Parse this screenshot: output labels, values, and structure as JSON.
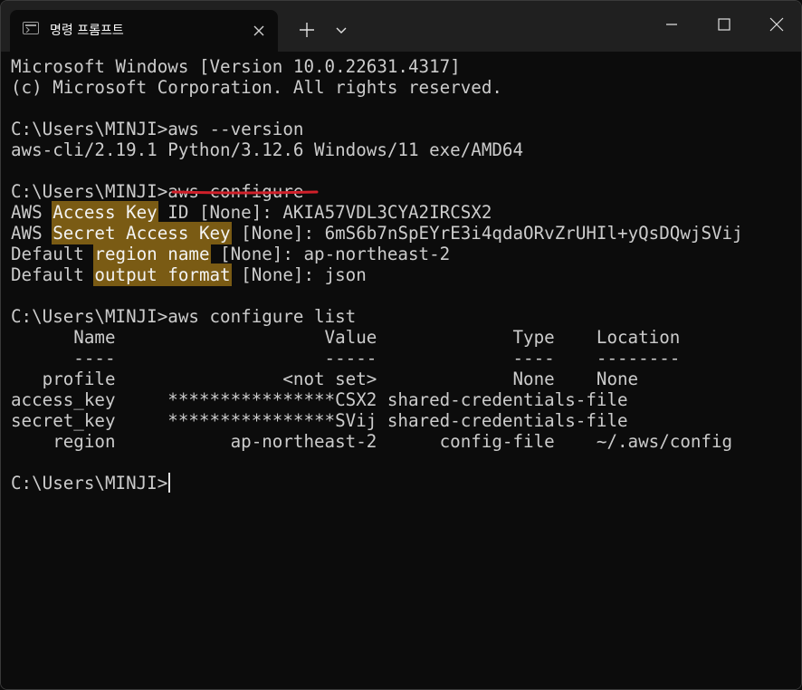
{
  "tab": {
    "title": "명령 프롬프트"
  },
  "icons": {
    "tab_icon": "terminal-icon",
    "tab_close": "close-icon",
    "new_tab": "plus-icon",
    "dropdown": "chevron-down-icon",
    "minimize": "minimize-icon",
    "maximize": "maximize-icon",
    "close": "close-icon"
  },
  "colors": {
    "highlight": "#7a5b14",
    "underline": "#d0202a",
    "text": "#cccccc",
    "background": "#0c0c0c"
  },
  "terminal": {
    "l1": "Microsoft Windows [Version 10.0.22631.4317]",
    "l2": "(c) Microsoft Corporation. All rights reserved.",
    "l4": "C:\\Users\\MINJI>aws --version",
    "l5": "aws-cli/2.19.1 Python/3.12.6 Windows/11 exe/AMD64",
    "l7_prompt": "C:\\Users\\MINJI>",
    "l7_cmd": "aws configure",
    "l8_a": "AWS ",
    "l8_hl": "Access Key",
    "l8_b": " ID [None]: AKIA57VDL3CYA2IRCSX2",
    "l9_a": "AWS ",
    "l9_hl": "Secret Access Key",
    "l9_b": " [None]: 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",
    "l10_a": "Default ",
    "l10_hl": "region name",
    "l10_b": " [None]: ap-northeast-2",
    "l11_a": "Default ",
    "l11_hl": "output format",
    "l11_b": " [None]: json",
    "l13": "C:\\Users\\MINJI>aws configure list",
    "list_header": "      Name                    Value             Type    Location",
    "list_rule": "      ----                    -----             ----    --------",
    "list_rows": [
      "   profile                <not set>             None    None",
      "access_key     ****************CSX2 shared-credentials-file",
      "secret_key     ****************SVij shared-credentials-file",
      "    region           ap-northeast-2      config-file    ~/.aws/config"
    ],
    "final_prompt": "C:\\Users\\MINJI>"
  }
}
